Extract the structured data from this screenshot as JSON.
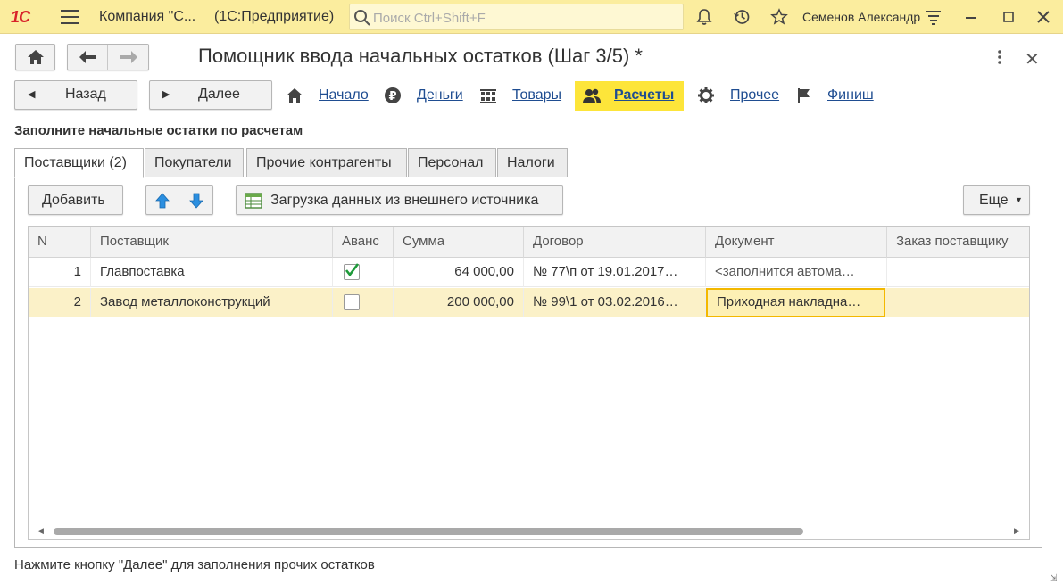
{
  "topbar": {
    "logo": "1С",
    "company": "Компания \"С...",
    "app": "(1С:Предприятие)",
    "search_placeholder": "Поиск Ctrl+Shift+F",
    "user": "Семенов Александр"
  },
  "header": {
    "title": "Помощник ввода начальных остатков (Шаг 3/5) *"
  },
  "nav": {
    "back_label": "Назад",
    "next_label": "Далее",
    "steps": [
      {
        "label": "Начало",
        "icon": "home-icon"
      },
      {
        "label": "Деньги",
        "icon": "ruble-icon"
      },
      {
        "label": "Товары",
        "icon": "warehouse-icon"
      },
      {
        "label": "Расчеты",
        "icon": "people-icon",
        "active": true
      },
      {
        "label": "Прочее",
        "icon": "gear-icon"
      },
      {
        "label": "Финиш",
        "icon": "flag-icon"
      }
    ]
  },
  "section_title": "Заполните начальные остатки по расчетам",
  "tabs": [
    "Поставщики (2)",
    "Покупатели",
    "Прочие контрагенты",
    "Персонал",
    "Налоги"
  ],
  "toolbar": {
    "add_label": "Добавить",
    "load_label": "Загрузка данных из внешнего источника",
    "more_label": "Еще"
  },
  "table": {
    "columns": [
      "N",
      "Поставщик",
      "Аванс",
      "Сумма",
      "Договор",
      "Документ",
      "Заказ поставщику"
    ],
    "rows": [
      {
        "n": "1",
        "supplier": "Главпоставка",
        "advance": true,
        "sum": "64 000,00",
        "contract": "№ 77\\п от 19.01.2017…",
        "document": "<заполнится автома…",
        "order": ""
      },
      {
        "n": "2",
        "supplier": "Завод металлоконструкций",
        "advance": false,
        "sum": "200 000,00",
        "contract": "№ 99\\1 от 03.02.2016…",
        "document": "Приходная накладна…",
        "order": ""
      }
    ]
  },
  "hint": "Нажмите кнопку \"Далее\" для заполнения прочих остатков",
  "colors": {
    "topbar": "#fbed9e",
    "active_step": "#fde53a",
    "link": "#1f4d91",
    "selected_row": "#fbf1c8",
    "focus_border": "#f3b800"
  }
}
